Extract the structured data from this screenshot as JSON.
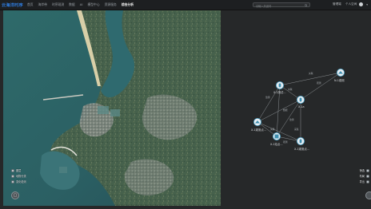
{
  "header": {
    "brand": "云海洋时序",
    "nav": [
      "首页",
      "海岸带",
      "时序观测",
      "数据",
      "AI",
      "模型中心",
      "资源服务",
      "综合分析"
    ],
    "active_index": 7,
    "search_placeholder": "请输入关键词",
    "right_links": [
      "管理端",
      "个人空间"
    ]
  },
  "map": {
    "controls": [
      "图层",
      "地物分类",
      "变化检测"
    ],
    "button_icon": "chat-icon"
  },
  "graph": {
    "nodes": [
      {
        "label": "X-1测试..."
      },
      {
        "label": "X-1a"
      },
      {
        "label": "N-1观测"
      },
      {
        "label": "X-1观测点..."
      },
      {
        "label": "X-1站点..."
      },
      {
        "label": "X-1观测点..."
      }
    ],
    "edge_labels": [
      "监测",
      "关联",
      "观测",
      "关联",
      "数据",
      "监测",
      "关联",
      "采集",
      "观测"
    ],
    "right_controls": [
      "筛选",
      "布局",
      "导出"
    ]
  },
  "colors": {
    "accent": "#2f7de1",
    "background": "#262829",
    "node_fill": "#e9eef2",
    "edge": "#8c9194"
  }
}
